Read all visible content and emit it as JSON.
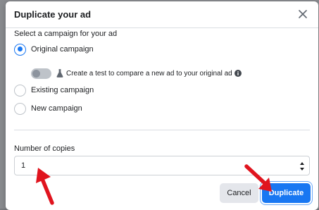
{
  "dialog": {
    "title": "Duplicate your ad",
    "close_icon": "close-icon"
  },
  "campaign": {
    "section_label": "Select a campaign for your ad",
    "options": [
      {
        "label": "Original campaign",
        "selected": true
      },
      {
        "label": "Existing campaign",
        "selected": false
      },
      {
        "label": "New campaign",
        "selected": false
      }
    ],
    "test_toggle": {
      "label": "Create a test to compare a new ad to your original ad",
      "enabled": false,
      "icon": "flask-icon",
      "info_icon": "info-icon"
    }
  },
  "copies": {
    "label": "Number of copies",
    "value": "1"
  },
  "footer": {
    "cancel_label": "Cancel",
    "duplicate_label": "Duplicate"
  },
  "colors": {
    "accent": "#1877f2",
    "annotation_arrow": "#e0141e"
  }
}
